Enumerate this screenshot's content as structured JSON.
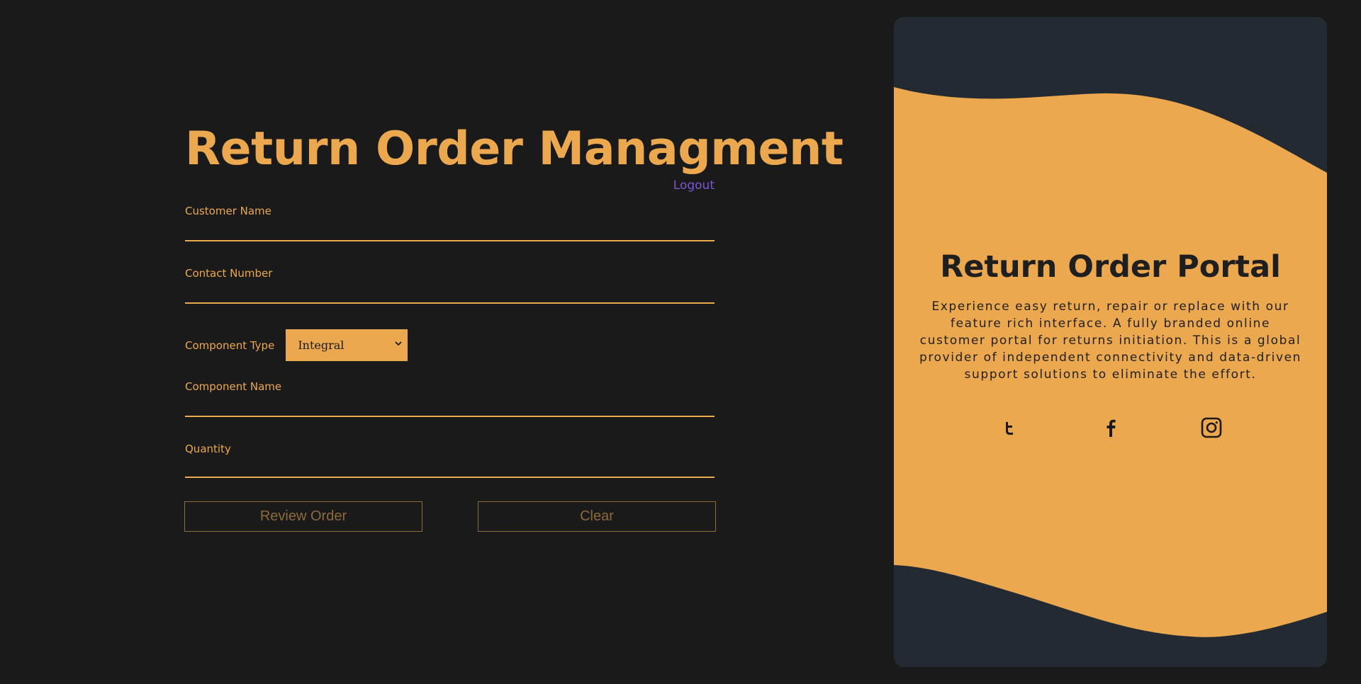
{
  "form": {
    "title": "Return Order Managment",
    "logout_label": "Logout",
    "fields": {
      "customer_name": {
        "label": "Customer Name",
        "value": ""
      },
      "contact_number": {
        "label": "Contact Number",
        "value": ""
      },
      "component_type": {
        "label": "Component Type",
        "selected": "Integral"
      },
      "component_name": {
        "label": "Component Name",
        "value": ""
      },
      "quantity": {
        "label": "Quantity",
        "value": ""
      }
    },
    "buttons": {
      "review_label": "Review Order",
      "clear_label": "Clear"
    }
  },
  "card": {
    "title": "Return Order Portal",
    "description": "Experience easy return, repair or replace with our feature rich interface. A fully branded online customer portal for returns initiation. This is a global provider of independent connectivity and data-driven support solutions to eliminate the effort.",
    "social_icons": [
      "twitter-icon",
      "facebook-icon",
      "instagram-icon"
    ]
  },
  "colors": {
    "background": "#1a1a1a",
    "accent": "#eca84f",
    "link": "#7a55d6",
    "card_dark": "#242a31",
    "button_muted": "#8c6a3b"
  }
}
